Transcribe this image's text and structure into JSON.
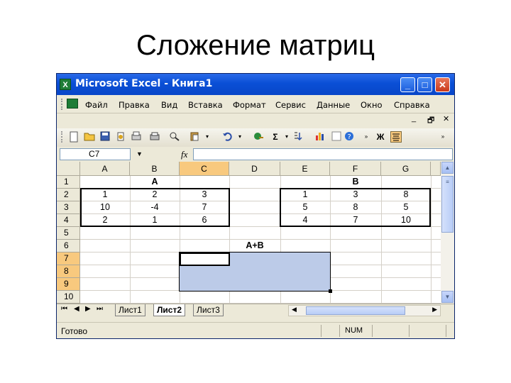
{
  "slide": {
    "title": "Сложение матриц"
  },
  "window": {
    "title": "Microsoft Excel - Книга1",
    "minimize_label": "_",
    "maximize_label": "□",
    "close_label": "✕"
  },
  "menu": {
    "items": [
      "Файл",
      "Правка",
      "Вид",
      "Вставка",
      "Формат",
      "Сервис",
      "Данные",
      "Окно",
      "Справка"
    ],
    "minimize_label": "_",
    "restore_label": "🗗",
    "close_label": "✕"
  },
  "toolbar": {
    "icons": [
      "new-icon",
      "open-icon",
      "save-icon",
      "permission-icon",
      "print-preview-icon",
      "print-icon",
      "spelling-icon",
      "paste-icon",
      "undo-icon",
      "hyperlink-icon",
      "autosum-icon",
      "sort-icon",
      "chart-icon",
      "help-icon",
      "bold-icon",
      "align-icon"
    ],
    "autosum_symbol": "Σ",
    "bold_label": "Ж"
  },
  "formula_bar": {
    "name_box": "C7",
    "fx_label": "fx",
    "formula": ""
  },
  "grid": {
    "columns": [
      "A",
      "B",
      "C",
      "D",
      "E",
      "F",
      "G"
    ],
    "selected_column": "C",
    "rows": [
      "1",
      "2",
      "3",
      "4",
      "5",
      "6",
      "7",
      "8",
      "9",
      "10"
    ],
    "selected_rows": [
      "7",
      "8",
      "9"
    ],
    "cells": {
      "B1": "A",
      "F1": "B",
      "A2": "1",
      "B2": "2",
      "C2": "3",
      "E2": "1",
      "F2": "3",
      "G2": "8",
      "A3": "10",
      "B3": "-4",
      "C3": "7",
      "E3": "5",
      "F3": "8",
      "G3": "5",
      "A4": "2",
      "B4": "1",
      "C4": "6",
      "E4": "4",
      "F4": "7",
      "G4": "10",
      "D6": "A+B"
    },
    "selection": "C7:E9",
    "active_cell": "C7"
  },
  "sheets": {
    "tabs": [
      "Лист1",
      "Лист2",
      "Лист3"
    ],
    "active": "Лист2",
    "nav": [
      "⏮",
      "◀",
      "▶",
      "⏭"
    ]
  },
  "status": {
    "ready": "Готово",
    "num": "NUM"
  },
  "colors": {
    "titlebar": "#0a4fd6",
    "selection": "#bccbe8",
    "header_highlight": "#f8c97e",
    "chrome": "#ece9d8"
  }
}
